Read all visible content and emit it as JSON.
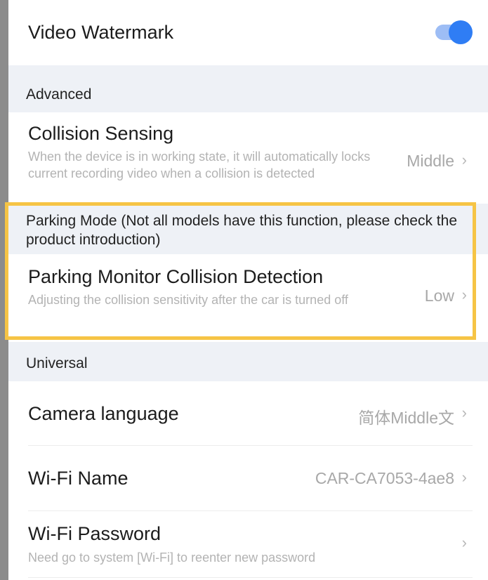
{
  "video_watermark": {
    "label": "Video Watermark",
    "enabled": true
  },
  "advanced": {
    "header": "Advanced",
    "collision_sensing": {
      "title": "Collision Sensing",
      "description": "When the device is in working state, it will automatically locks current recording video when a collision is detected",
      "value": "Middle"
    }
  },
  "parking_mode": {
    "header": "Parking Mode (Not all models have this function, please check the product introduction)",
    "collision_detection": {
      "title": "Parking Monitor Collision Detection",
      "description": "Adjusting the collision sensitivity after the car is turned off",
      "value": "Low"
    }
  },
  "universal": {
    "header": "Universal",
    "camera_language": {
      "title": "Camera language",
      "value": "简体Middle文"
    },
    "wifi_name": {
      "title": "Wi-Fi Name",
      "value": "CAR-CA7053-4ae8"
    },
    "wifi_password": {
      "title": "Wi-Fi Password",
      "description": "Need go to system [Wi-Fi] to reenter new password"
    }
  },
  "icons": {
    "chevron": "›"
  },
  "colors": {
    "accent": "#2f7df4",
    "highlight": "#f6c445",
    "section_bg": "#eef1f6"
  }
}
